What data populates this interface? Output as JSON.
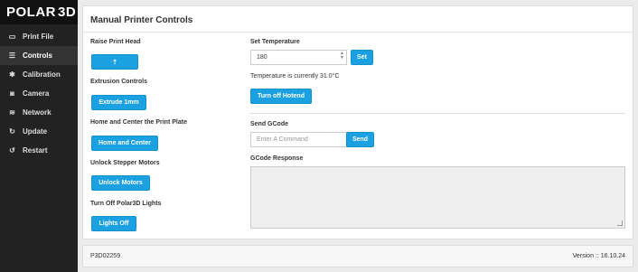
{
  "app": {
    "logo_text_left": "POLAR",
    "logo_text_right": "3D"
  },
  "sidebar": {
    "items": [
      {
        "label": "Print File",
        "icon": "file-icon"
      },
      {
        "label": "Controls",
        "icon": "sliders-icon"
      },
      {
        "label": "Calibration",
        "icon": "gear-icon"
      },
      {
        "label": "Camera",
        "icon": "camera-icon"
      },
      {
        "label": "Network",
        "icon": "wifi-icon"
      },
      {
        "label": "Update",
        "icon": "refresh-icon"
      },
      {
        "label": "Restart",
        "icon": "restart-icon"
      }
    ],
    "active_index": 1
  },
  "panel": {
    "title": "Manual Printer Controls",
    "raise_label": "Raise Print Head",
    "raise_button": "⇡",
    "extrusion_label": "Extrusion Controls",
    "extrude_button": "Extrude 1mm",
    "home_label": "Home and Center the Print Plate",
    "home_button": "Home and Center",
    "unlock_label": "Unlock Stepper Motors",
    "unlock_button": "Unlock Motors",
    "lights_label": "Turn Off Polar3D Lights",
    "lights_button": "Lights Off",
    "temp_label": "Set Temperature",
    "temp_value": "180",
    "temp_set_button": "Set",
    "temp_status": "Temperature is currently 31.0°C",
    "hotend_button": "Turn off Hotend",
    "gcode_label": "Send GCode",
    "gcode_placeholder": "Enter A Command",
    "gcode_send_button": "Send",
    "gcode_response_label": "GCode Response",
    "gcode_response_value": ""
  },
  "footer": {
    "device_id": "P3D02259",
    "version": "Version :: 16.10.24"
  },
  "colors": {
    "accent": "#1ba1e2",
    "sidebar_bg": "#222222"
  }
}
